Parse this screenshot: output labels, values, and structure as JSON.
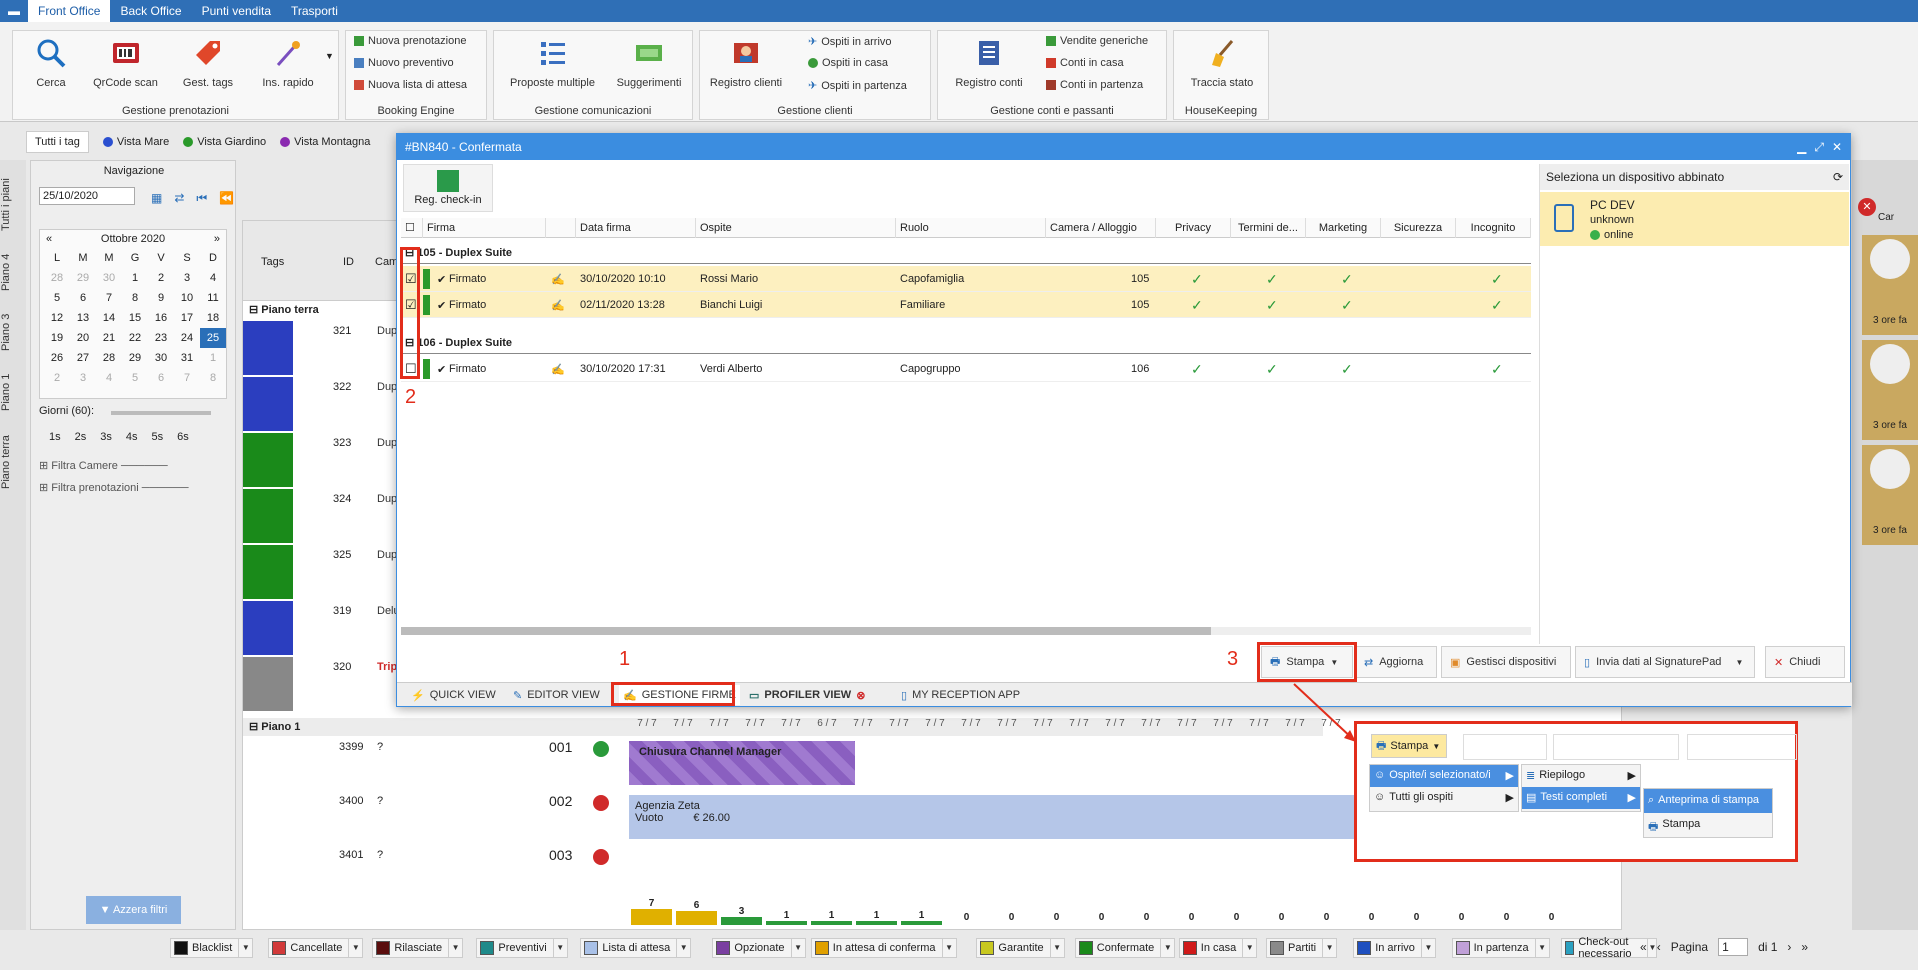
{
  "topnav": {
    "tabs": [
      "Front Office",
      "Back Office",
      "Punti vendita",
      "Trasporti"
    ]
  },
  "ribbon": {
    "gestione_prenotazioni": {
      "label": "Gestione prenotazioni",
      "buttons": [
        "Cerca",
        "QrCode scan",
        "Gest. tags",
        "Ins. rapido"
      ]
    },
    "booking_engine": {
      "label": "Booking Engine",
      "items": [
        "Nuova prenotazione",
        "Nuovo preventivo",
        "Nuova lista di attesa"
      ]
    },
    "gestione_comunicazioni": {
      "label": "Gestione comunicazioni",
      "buttons": [
        "Proposte multiple",
        "Suggerimenti"
      ]
    },
    "gestione_clienti": {
      "label": "Gestione clienti",
      "button": "Registro clienti",
      "items": [
        "Ospiti in arrivo",
        "Ospiti in casa",
        "Ospiti in partenza"
      ]
    },
    "gestione_conti": {
      "label": "Gestione conti e passanti",
      "button": "Registro conti",
      "items": [
        "Vendite generiche",
        "Conti in casa",
        "Conti in partenza"
      ]
    },
    "housekeeping": {
      "label": "HouseKeeping",
      "button": "Traccia stato"
    }
  },
  "tags_bar": {
    "items": [
      "Tutti i tag",
      "Vista Mare",
      "Vista Giardino",
      "Vista Montagna"
    ]
  },
  "vertical_tabs": [
    "Tutti i piani",
    "Piano 4",
    "Piano 3",
    "Piano 1",
    "Piano terra"
  ],
  "navigation": {
    "title": "Navigazione",
    "date": "25/10/2020"
  },
  "calendar": {
    "month": "Ottobre 2020",
    "weekdays": [
      "L",
      "M",
      "M",
      "G",
      "V",
      "S",
      "D"
    ],
    "weeks": [
      [
        "28",
        "29",
        "30",
        "1",
        "2",
        "3",
        "4"
      ],
      [
        "5",
        "6",
        "7",
        "8",
        "9",
        "10",
        "11"
      ],
      [
        "12",
        "13",
        "14",
        "15",
        "16",
        "17",
        "18"
      ],
      [
        "19",
        "20",
        "21",
        "22",
        "23",
        "24",
        "25"
      ],
      [
        "26",
        "27",
        "28",
        "29",
        "30",
        "31",
        "1"
      ],
      [
        "2",
        "3",
        "4",
        "5",
        "6",
        "7",
        "8"
      ]
    ],
    "giorni_label": "Giorni (60):",
    "durations": [
      "1s",
      "2s",
      "3s",
      "4s",
      "5s",
      "6s"
    ],
    "filtra_camere": "Filtra Camere",
    "filtra_prenotazioni": "Filtra prenotazioni",
    "azzera_filtri": "Azzera filtri"
  },
  "planning": {
    "headers": {
      "tags": "Tags",
      "id": "ID",
      "cam": "Cam"
    },
    "piano_terra": "Piano terra",
    "rows_pt": [
      {
        "id": "321",
        "type": "Dup"
      },
      {
        "id": "322",
        "type": "Dup"
      },
      {
        "id": "323",
        "type": "Dup"
      },
      {
        "id": "324",
        "type": "Dup"
      },
      {
        "id": "325",
        "type": "Dup"
      },
      {
        "id": "319",
        "type": "Delu"
      },
      {
        "id": "320",
        "type": "Trip"
      }
    ],
    "piano_1": "Piano 1",
    "rows_p1": [
      {
        "id": "3399",
        "q": "?",
        "room": "001"
      },
      {
        "id": "3400",
        "q": "?",
        "room": "002"
      },
      {
        "id": "3401",
        "q": "?",
        "room": "003"
      }
    ],
    "date_headers": [
      "7 / 7",
      "7 / 7",
      "7 / 7",
      "7 / 7",
      "7 / 7",
      "6 / 7",
      "7 / 7",
      "7 / 7",
      "7 / 7",
      "7 / 7",
      "7 / 7",
      "7 / 7",
      "7 / 7",
      "7 / 7",
      "7 / 7",
      "7 / 7",
      "7 / 7",
      "7 / 7",
      "7 / 7",
      "7 / 7"
    ],
    "channel_block": "Chiusura Channel Manager",
    "agency": "Agenzia Zeta",
    "vuoto": "Vuoto",
    "price": "€ 26.00",
    "counts": [
      "7",
      "6",
      "3",
      "1",
      "1",
      "1",
      "1",
      "0",
      "0",
      "0",
      "0",
      "0",
      "0",
      "0",
      "0",
      "0",
      "0",
      "0",
      "0",
      "0",
      "0"
    ]
  },
  "right_panel": {
    "labels": [
      "Car",
      "3 ore fa",
      "3 ore fa",
      "3 ore fa"
    ]
  },
  "modal": {
    "title": "#BN840 - Confermata",
    "reg_checkin": "Reg. check-in",
    "columns": [
      "Firma",
      "Data firma",
      "Ospite",
      "Ruolo",
      "Camera / Alloggio",
      "Privacy",
      "Termini de...",
      "Marketing",
      "Sicurezza",
      "Incognito"
    ],
    "groups": [
      {
        "title": "105 - Duplex Suite",
        "rows": [
          {
            "status": "Firmato",
            "date": "30/10/2020 10:10",
            "guest": "Rossi Mario",
            "role": "Capofamiglia",
            "room": "105"
          },
          {
            "status": "Firmato",
            "date": "02/11/2020 13:28",
            "guest": "Bianchi Luigi",
            "role": "Familiare",
            "room": "105"
          }
        ]
      },
      {
        "title": "106 - Duplex Suite",
        "rows": [
          {
            "status": "Firmato",
            "date": "30/10/2020 17:31",
            "guest": "Verdi Alberto",
            "role": "Capogruppo",
            "room": "106"
          }
        ]
      }
    ],
    "device_panel": {
      "title": "Seleziona un dispositivo abbinato",
      "name": "PC DEV",
      "sub": "unknown",
      "status": "online"
    },
    "buttons": {
      "stampa": "Stampa",
      "aggiorna": "Aggiorna",
      "gestisci": "Gestisci dispositivi",
      "invia": "Invia dati al SignaturePad",
      "chiudi": "Chiudi"
    },
    "tabs": [
      "QUICK VIEW",
      "EDITOR VIEW",
      "GESTIONE FIRME",
      "PROFILER VIEW",
      "MY RECEPTION APP"
    ]
  },
  "annotations": {
    "n1": "1",
    "n2": "2",
    "n3": "3"
  },
  "zoom": {
    "stampa": "Stampa",
    "menu1": [
      "Ospite/i selezionato/i",
      "Tutti gli ospiti"
    ],
    "menu2": [
      "Riepilogo",
      "Testi completi"
    ],
    "menu3": [
      "Anteprima di stampa",
      "Stampa"
    ]
  },
  "legend": [
    "Blacklist",
    "Cancellate",
    "Rilasciate",
    "Preventivi",
    "Lista di attesa",
    "Opzionate",
    "In attesa di conferma",
    "Garantite",
    "Confermate",
    "In casa",
    "Partiti",
    "In arrivo",
    "In partenza",
    "Check-out necessario"
  ],
  "legend_colors": [
    "#111111",
    "#d23a3a",
    "#5a0d0d",
    "#1f8a8a",
    "#a9c1e8",
    "#7a3fa0",
    "#e0a000",
    "#c8c820",
    "#1a8a1a",
    "#d01a1a",
    "#8a8a8a",
    "#1e4fbf",
    "#c0a0d8",
    "#2aa0c0"
  ],
  "pager": {
    "label": "Pagina",
    "value": "1",
    "of": "di 1"
  }
}
